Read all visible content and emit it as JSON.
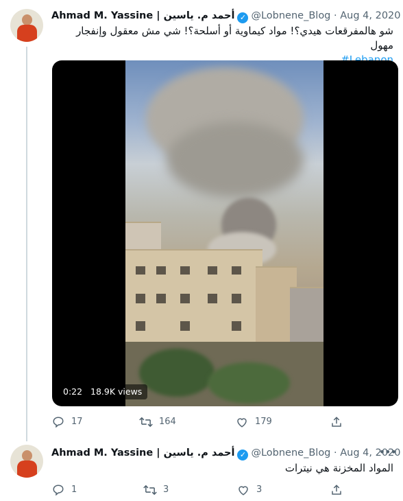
{
  "tweets": [
    {
      "author_name": "Ahmad M. Yassine | أحمد م. ياسين",
      "handle": "@Lobnene_Blog",
      "date": "· Aug 4, 2020",
      "text_line1": "شو هالمفرقعات هيدي؟! مواد كيماوية أو أسلحة؟! شي مش معقول وإنفجار مهول",
      "hashtag": "#Lebanon",
      "video": {
        "time": "0:22",
        "views": "18.9K views"
      },
      "replies": "17",
      "retweets": "164",
      "likes": "179"
    },
    {
      "author_name": "Ahmad M. Yassine | أحمد م. ياسين",
      "handle": "@Lobnene_Blog",
      "date": "· Aug 4, 2020",
      "text_line1": "المواد المخزنة هي نيترات",
      "replies": "1",
      "retweets": "3",
      "likes": "3"
    }
  ],
  "icons": {
    "verified": "verified-badge-icon",
    "more": "more-options-icon",
    "reply": "reply-icon",
    "retweet": "retweet-icon",
    "like": "like-heart-icon",
    "share": "share-icon"
  },
  "colors": {
    "accent": "#1d9bf0",
    "muted": "#536471",
    "thread_line": "#cfd9de"
  }
}
